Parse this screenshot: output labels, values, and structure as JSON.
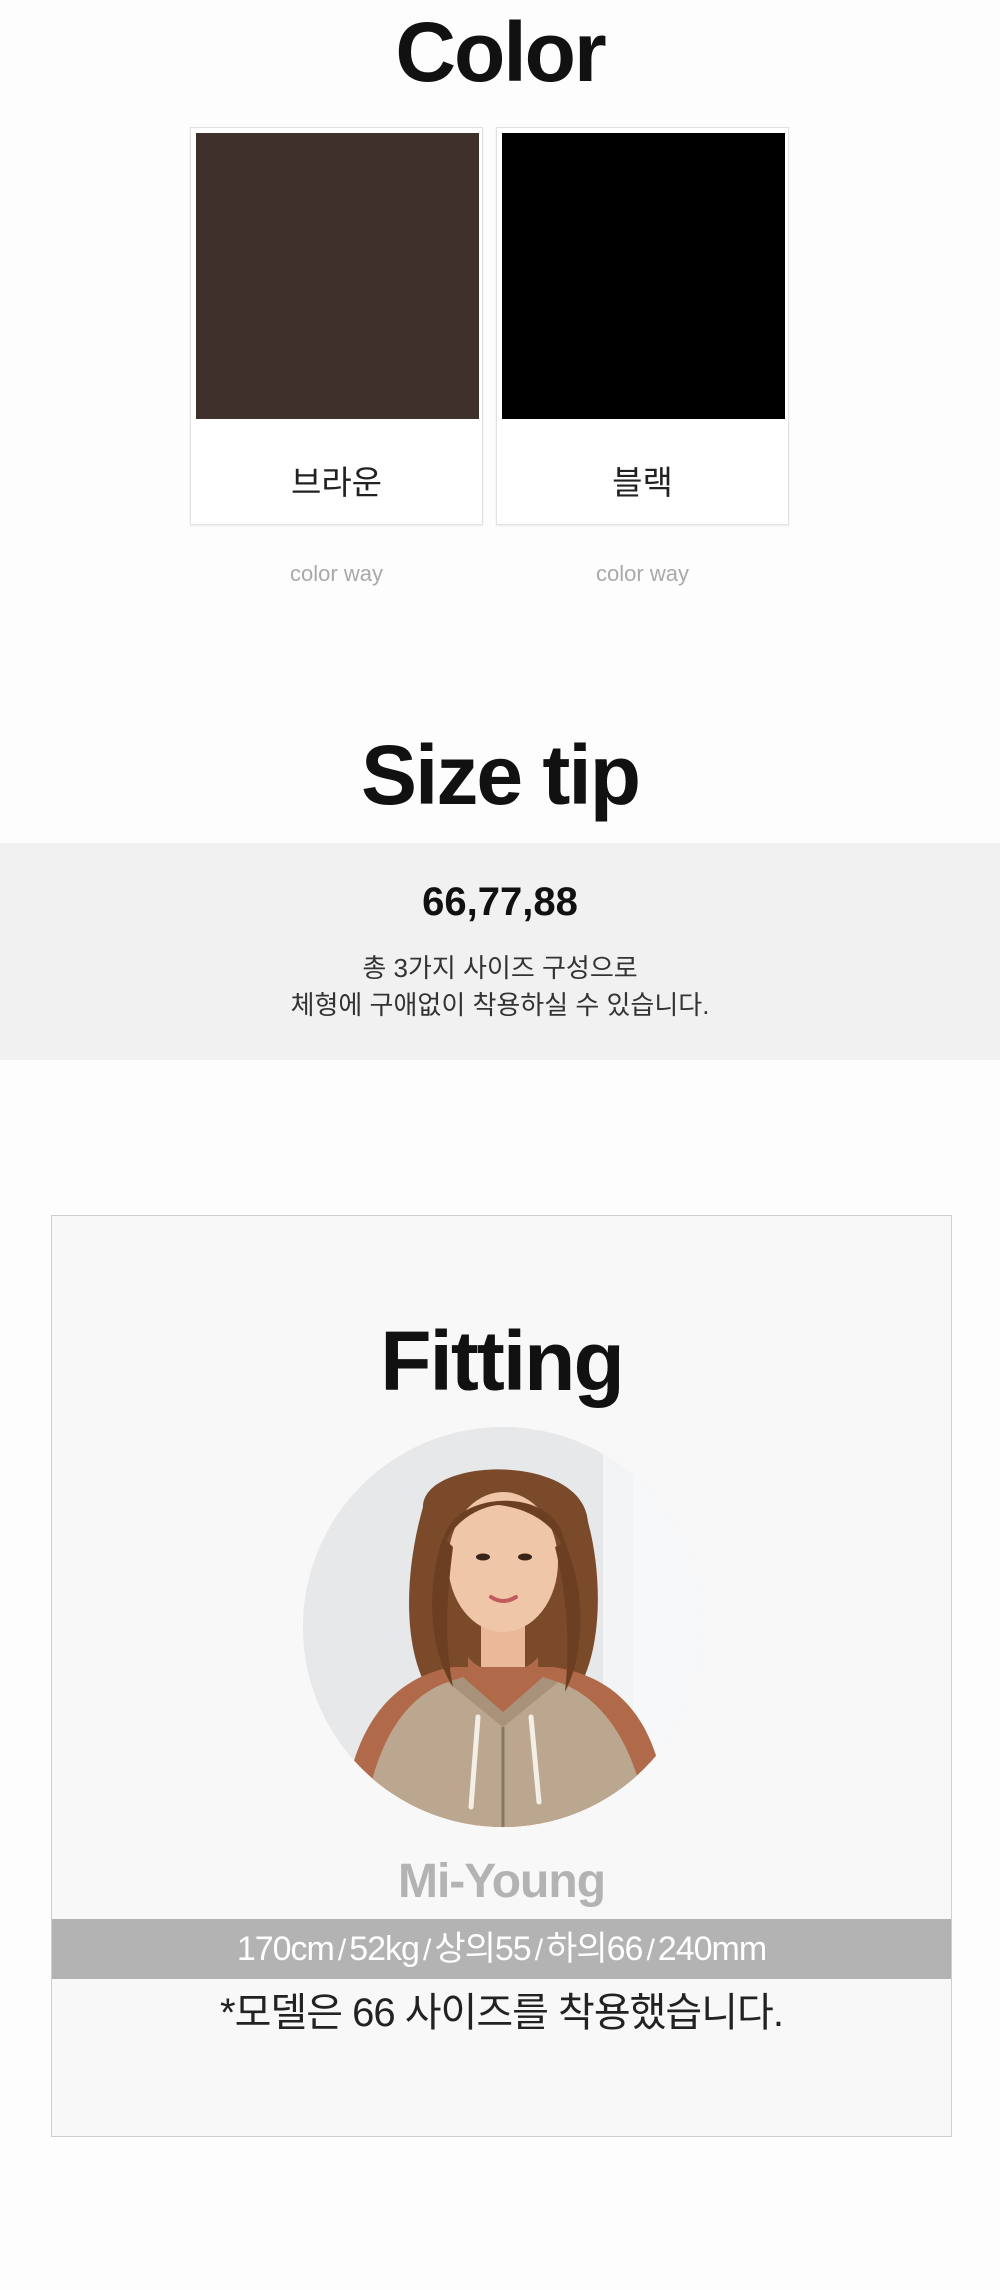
{
  "color_section": {
    "title": "Color",
    "swatches": [
      {
        "label": "color way",
        "name": "브라운",
        "color": "#3e312b"
      },
      {
        "label": "color way",
        "name": "블랙",
        "color": "#000000"
      }
    ]
  },
  "size_section": {
    "title": "Size tip",
    "sizes": "66,77,88",
    "description_line1": "총 3가지 사이즈 구성으로",
    "description_line2": "체형에 구애없이 착용하실 수 있습니다.",
    "band_color": "#f1f1f1"
  },
  "fitting_section": {
    "title": "Fitting",
    "model_name": "Mi-Young",
    "stats": [
      "170cm",
      "52kg",
      "상의55",
      "하의66",
      "240mm"
    ],
    "stats_separator": "/",
    "note": "*모델은 66 사이즈를 착용했습니다.",
    "stats_bar_color": "#b3b3b3"
  }
}
